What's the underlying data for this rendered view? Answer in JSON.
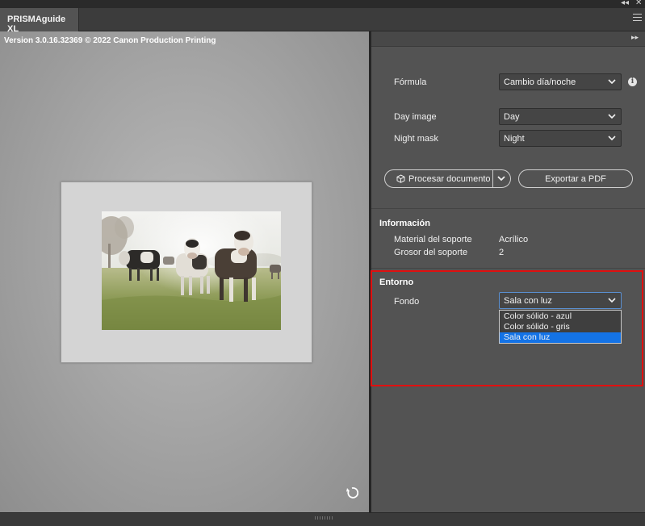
{
  "window": {
    "tab_title": "PRISMAguide XL",
    "collapse_icon": "double-chevron-left-icon",
    "close_icon": "close-icon",
    "menu_icon": "hamburger-menu-icon"
  },
  "preview": {
    "version_text": "Version 3.0.16.32369 © 2022 Canon Production Printing",
    "rotate_icon": "rotate-icon"
  },
  "panel": {
    "expand_icon": "double-chevron-right-icon",
    "formula": {
      "label": "Fórmula",
      "value": "Cambio día/noche"
    },
    "day_image": {
      "label": "Day image",
      "value": "Day"
    },
    "night_mask": {
      "label": "Night mask",
      "value": "Night"
    },
    "process_button": "Procesar documento",
    "export_button": "Exportar a PDF",
    "info": {
      "title": "Información",
      "rows": [
        {
          "label": "Material del soporte",
          "value": "Acrílico"
        },
        {
          "label": "Grosor del soporte",
          "value": "2"
        }
      ]
    },
    "environment": {
      "title": "Entorno",
      "background_label": "Fondo",
      "background_value": "Sala con luz",
      "options": [
        "Color sólido - azul",
        "Color sólido - gris",
        "Sala con luz"
      ],
      "selected_index": 2
    }
  },
  "colors": {
    "accent": "#1473e6",
    "highlight_border": "#e01010",
    "panel_bg": "#535353"
  }
}
